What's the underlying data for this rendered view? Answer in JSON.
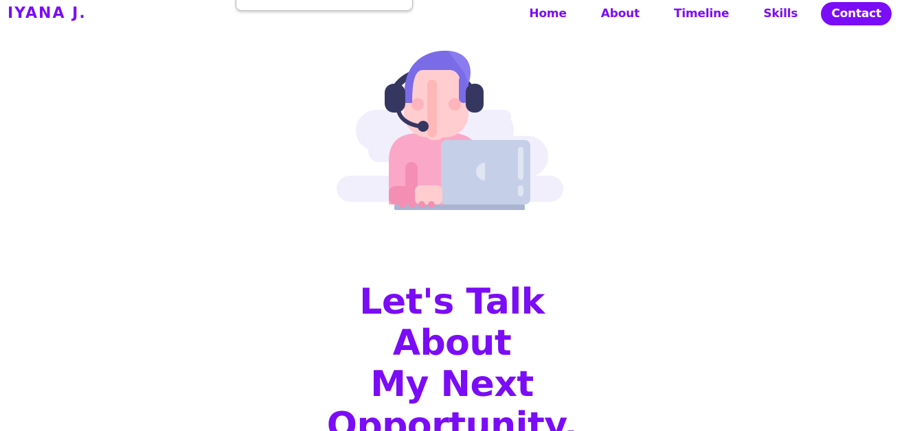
{
  "header": {
    "brand": "IYANA J.",
    "floating_card_text": "”"
  },
  "nav": {
    "items": [
      {
        "label": "Home"
      },
      {
        "label": "About"
      },
      {
        "label": "Timeline"
      },
      {
        "label": "Skills"
      },
      {
        "label": "Contact"
      }
    ]
  },
  "hero": {
    "illustration": "person-with-headset-at-laptop",
    "lines": [
      "Let's Talk",
      "About",
      "My Next",
      "Opportunity."
    ]
  },
  "colors": {
    "accent": "#7b0cf7",
    "background": "#ffffff",
    "hair": "#7a6be6",
    "shirt": "#fba8c8",
    "laptop": "#c5cfe8"
  }
}
